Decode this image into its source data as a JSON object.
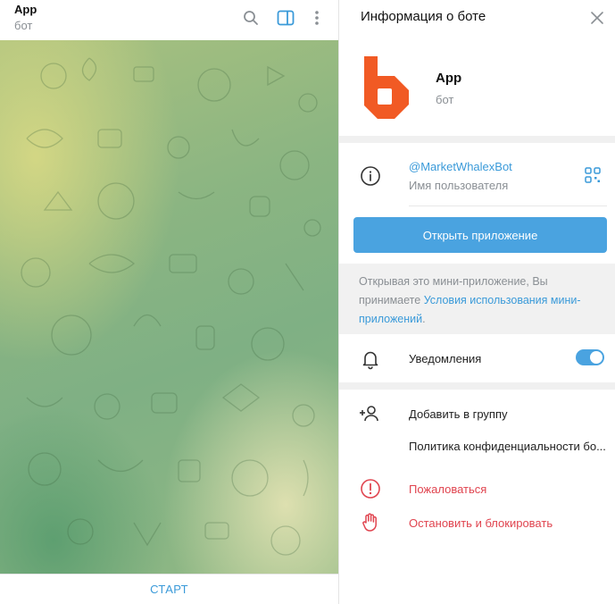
{
  "chat": {
    "title": "App",
    "subtitle": "бот",
    "start_label": "СТАРТ"
  },
  "header_icons": [
    "search-icon",
    "sidebar-toggle-icon",
    "more-vertical-icon"
  ],
  "info": {
    "title": "Информация о боте",
    "bot_name": "App",
    "bot_type": "бот",
    "username": "@MarketWhalexBot",
    "username_label": "Имя пользователя",
    "open_app_label": "Открыть приложение",
    "notice_prefix": "Открывая это мини-приложение, Вы принимаете ",
    "notice_link": "Условия использования мини-приложений",
    "notice_suffix": ".",
    "notifications_label": "Уведомления",
    "notifications_enabled": true,
    "add_to_group_label": "Добавить в группу",
    "privacy_label": "Политика конфиденциальности бо...",
    "report_label": "Пожаловаться",
    "block_label": "Остановить и блокировать"
  },
  "colors": {
    "accent": "#4aa3e0",
    "link": "#3a9ad9",
    "danger": "#e0444f",
    "logo": "#f15a24"
  }
}
